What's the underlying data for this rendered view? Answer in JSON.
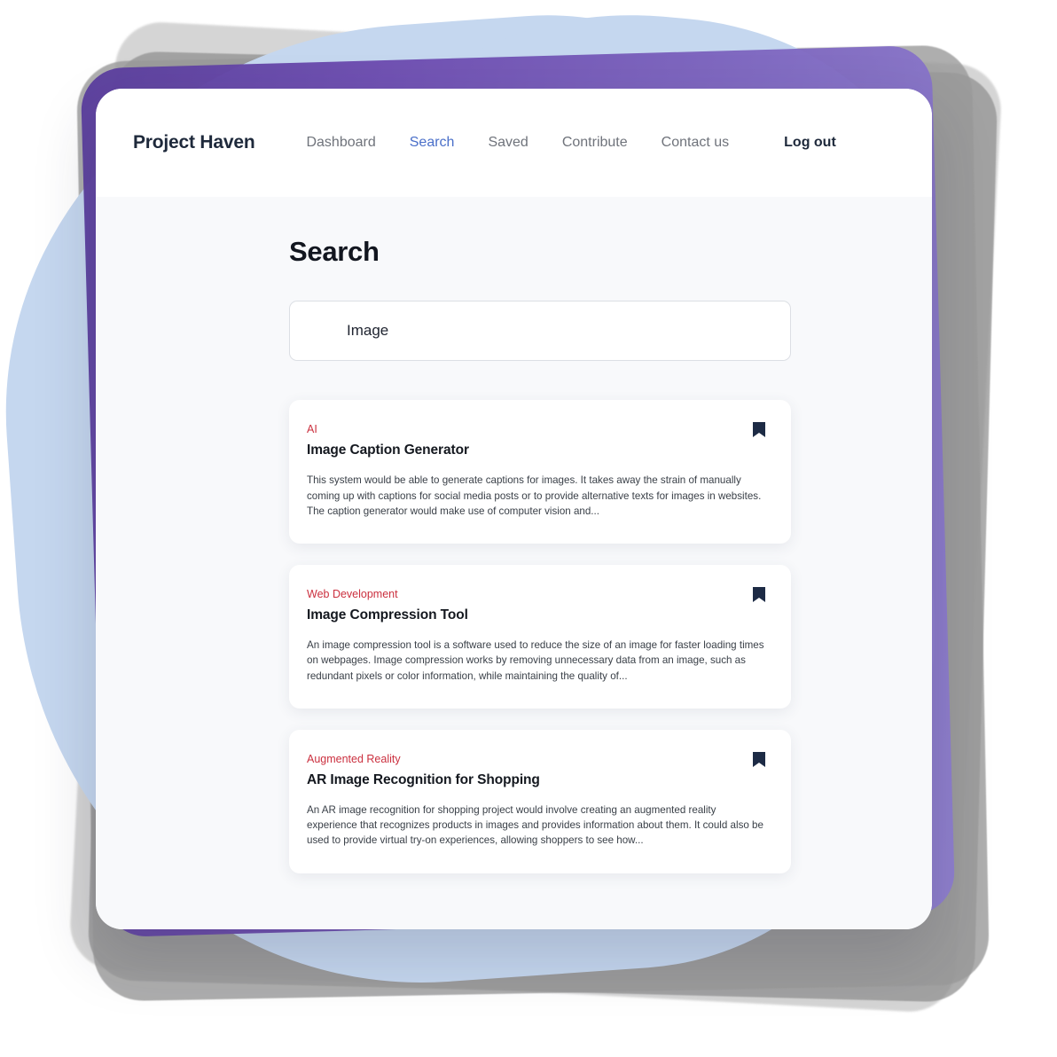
{
  "colors": {
    "accent_blue": "#4a6fc9",
    "category_red": "#cb303f",
    "navy": "#1e293b",
    "nav_grey": "#6f737b",
    "blob_blue": "#c5d7ef",
    "purple": "#6d4cb0"
  },
  "header": {
    "brand": "Project Haven",
    "nav": [
      {
        "label": "Dashboard",
        "active": false
      },
      {
        "label": "Search",
        "active": true
      },
      {
        "label": "Saved",
        "active": false
      },
      {
        "label": "Contribute",
        "active": false
      },
      {
        "label": "Contact us",
        "active": false
      }
    ],
    "logout_label": "Log out"
  },
  "main": {
    "page_title": "Search",
    "search": {
      "value": "Image",
      "placeholder": "Image"
    },
    "results": [
      {
        "category": "AI",
        "title": "Image Caption Generator",
        "description": "This system would be able to generate captions for images. It takes away the strain of manually coming up with captions for social media posts or to provide alternative texts for images in websites. The caption generator would make use of computer vision and...",
        "bookmark_icon": "bookmark-icon"
      },
      {
        "category": "Web Development",
        "title": "Image Compression Tool",
        "description": "An image compression tool is a software used to reduce the size of an image for faster loading times on webpages. Image compression works by removing unnecessary data from an image, such as redundant pixels or color information, while maintaining the quality of...",
        "bookmark_icon": "bookmark-icon"
      },
      {
        "category": "Augmented Reality",
        "title": "AR Image Recognition for Shopping",
        "description": "An AR image recognition for shopping project would involve creating an augmented reality experience that recognizes products in images and provides information about them. It could also be used to provide virtual try-on experiences, allowing shoppers to see how...",
        "bookmark_icon": "bookmark-icon"
      }
    ]
  }
}
